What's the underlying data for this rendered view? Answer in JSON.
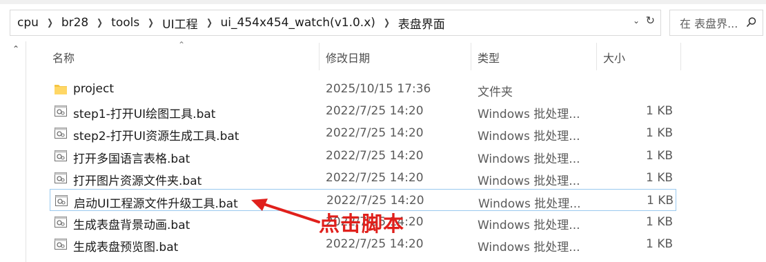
{
  "breadcrumb": [
    "cpu",
    "br28",
    "tools",
    "UI工程",
    "ui_454x454_watch(v1.0.x)",
    "表盘界面"
  ],
  "search": {
    "placeholder": "在 表盘界... ",
    "icon": "search-icon"
  },
  "columns": {
    "name": "名称",
    "modified": "修改日期",
    "type": "类型",
    "size": "大小"
  },
  "files": [
    {
      "name": "project",
      "modified": "2025/10/15 17:36",
      "type": "文件夹",
      "size": "",
      "icon": "folder-icon"
    },
    {
      "name": "step1-打开UI绘图工具.bat",
      "modified": "2022/7/25 14:20",
      "type": "Windows 批处理...",
      "size": "1 KB",
      "icon": "batch-file-icon"
    },
    {
      "name": "step2-打开UI资源生成工具.bat",
      "modified": "2022/7/25 14:20",
      "type": "Windows 批处理...",
      "size": "1 KB",
      "icon": "batch-file-icon"
    },
    {
      "name": "打开多国语言表格.bat",
      "modified": "2022/7/25 14:20",
      "type": "Windows 批处理...",
      "size": "1 KB",
      "icon": "batch-file-icon"
    },
    {
      "name": "打开图片资源文件夹.bat",
      "modified": "2022/7/25 14:20",
      "type": "Windows 批处理...",
      "size": "1 KB",
      "icon": "batch-file-icon"
    },
    {
      "name": "启动UI工程源文件升级工具.bat",
      "modified": "2022/7/25 14:20",
      "type": "Windows 批处理...",
      "size": "1 KB",
      "icon": "batch-file-icon",
      "selected": true
    },
    {
      "name": "生成表盘背景动画.bat",
      "modified": "2022/7/25 14:20",
      "type": "Windows 批处理...",
      "size": "1 KB",
      "icon": "batch-file-icon"
    },
    {
      "name": "生成表盘预览图.bat",
      "modified": "2022/7/25 14:20",
      "type": "Windows 批处理...",
      "size": "1 KB",
      "icon": "batch-file-icon"
    }
  ],
  "annotation": {
    "text": "点击脚本",
    "color": "#e0201c"
  },
  "colors": {
    "selection_border": "#99c9ef",
    "folder": "#f5c542"
  }
}
